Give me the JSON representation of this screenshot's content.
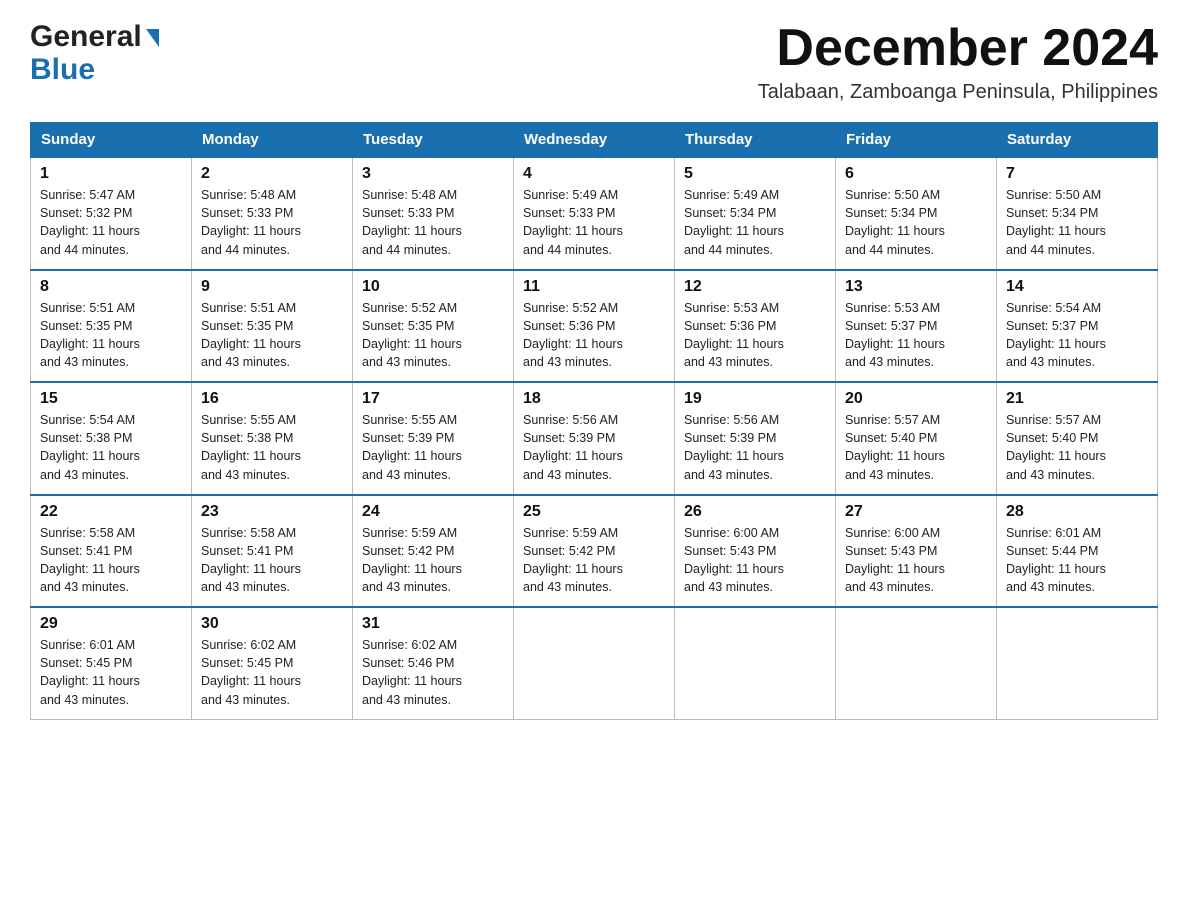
{
  "header": {
    "logo": {
      "general": "General",
      "blue": "Blue"
    },
    "title": "December 2024",
    "location": "Talabaan, Zamboanga Peninsula, Philippines"
  },
  "calendar": {
    "days_of_week": [
      "Sunday",
      "Monday",
      "Tuesday",
      "Wednesday",
      "Thursday",
      "Friday",
      "Saturday"
    ],
    "weeks": [
      [
        {
          "day": "1",
          "sunrise": "5:47 AM",
          "sunset": "5:32 PM",
          "daylight": "11 hours and 44 minutes."
        },
        {
          "day": "2",
          "sunrise": "5:48 AM",
          "sunset": "5:33 PM",
          "daylight": "11 hours and 44 minutes."
        },
        {
          "day": "3",
          "sunrise": "5:48 AM",
          "sunset": "5:33 PM",
          "daylight": "11 hours and 44 minutes."
        },
        {
          "day": "4",
          "sunrise": "5:49 AM",
          "sunset": "5:33 PM",
          "daylight": "11 hours and 44 minutes."
        },
        {
          "day": "5",
          "sunrise": "5:49 AM",
          "sunset": "5:34 PM",
          "daylight": "11 hours and 44 minutes."
        },
        {
          "day": "6",
          "sunrise": "5:50 AM",
          "sunset": "5:34 PM",
          "daylight": "11 hours and 44 minutes."
        },
        {
          "day": "7",
          "sunrise": "5:50 AM",
          "sunset": "5:34 PM",
          "daylight": "11 hours and 44 minutes."
        }
      ],
      [
        {
          "day": "8",
          "sunrise": "5:51 AM",
          "sunset": "5:35 PM",
          "daylight": "11 hours and 43 minutes."
        },
        {
          "day": "9",
          "sunrise": "5:51 AM",
          "sunset": "5:35 PM",
          "daylight": "11 hours and 43 minutes."
        },
        {
          "day": "10",
          "sunrise": "5:52 AM",
          "sunset": "5:35 PM",
          "daylight": "11 hours and 43 minutes."
        },
        {
          "day": "11",
          "sunrise": "5:52 AM",
          "sunset": "5:36 PM",
          "daylight": "11 hours and 43 minutes."
        },
        {
          "day": "12",
          "sunrise": "5:53 AM",
          "sunset": "5:36 PM",
          "daylight": "11 hours and 43 minutes."
        },
        {
          "day": "13",
          "sunrise": "5:53 AM",
          "sunset": "5:37 PM",
          "daylight": "11 hours and 43 minutes."
        },
        {
          "day": "14",
          "sunrise": "5:54 AM",
          "sunset": "5:37 PM",
          "daylight": "11 hours and 43 minutes."
        }
      ],
      [
        {
          "day": "15",
          "sunrise": "5:54 AM",
          "sunset": "5:38 PM",
          "daylight": "11 hours and 43 minutes."
        },
        {
          "day": "16",
          "sunrise": "5:55 AM",
          "sunset": "5:38 PM",
          "daylight": "11 hours and 43 minutes."
        },
        {
          "day": "17",
          "sunrise": "5:55 AM",
          "sunset": "5:39 PM",
          "daylight": "11 hours and 43 minutes."
        },
        {
          "day": "18",
          "sunrise": "5:56 AM",
          "sunset": "5:39 PM",
          "daylight": "11 hours and 43 minutes."
        },
        {
          "day": "19",
          "sunrise": "5:56 AM",
          "sunset": "5:39 PM",
          "daylight": "11 hours and 43 minutes."
        },
        {
          "day": "20",
          "sunrise": "5:57 AM",
          "sunset": "5:40 PM",
          "daylight": "11 hours and 43 minutes."
        },
        {
          "day": "21",
          "sunrise": "5:57 AM",
          "sunset": "5:40 PM",
          "daylight": "11 hours and 43 minutes."
        }
      ],
      [
        {
          "day": "22",
          "sunrise": "5:58 AM",
          "sunset": "5:41 PM",
          "daylight": "11 hours and 43 minutes."
        },
        {
          "day": "23",
          "sunrise": "5:58 AM",
          "sunset": "5:41 PM",
          "daylight": "11 hours and 43 minutes."
        },
        {
          "day": "24",
          "sunrise": "5:59 AM",
          "sunset": "5:42 PM",
          "daylight": "11 hours and 43 minutes."
        },
        {
          "day": "25",
          "sunrise": "5:59 AM",
          "sunset": "5:42 PM",
          "daylight": "11 hours and 43 minutes."
        },
        {
          "day": "26",
          "sunrise": "6:00 AM",
          "sunset": "5:43 PM",
          "daylight": "11 hours and 43 minutes."
        },
        {
          "day": "27",
          "sunrise": "6:00 AM",
          "sunset": "5:43 PM",
          "daylight": "11 hours and 43 minutes."
        },
        {
          "day": "28",
          "sunrise": "6:01 AM",
          "sunset": "5:44 PM",
          "daylight": "11 hours and 43 minutes."
        }
      ],
      [
        {
          "day": "29",
          "sunrise": "6:01 AM",
          "sunset": "5:45 PM",
          "daylight": "11 hours and 43 minutes."
        },
        {
          "day": "30",
          "sunrise": "6:02 AM",
          "sunset": "5:45 PM",
          "daylight": "11 hours and 43 minutes."
        },
        {
          "day": "31",
          "sunrise": "6:02 AM",
          "sunset": "5:46 PM",
          "daylight": "11 hours and 43 minutes."
        },
        null,
        null,
        null,
        null
      ]
    ],
    "labels": {
      "sunrise": "Sunrise:",
      "sunset": "Sunset:",
      "daylight": "Daylight:"
    }
  }
}
